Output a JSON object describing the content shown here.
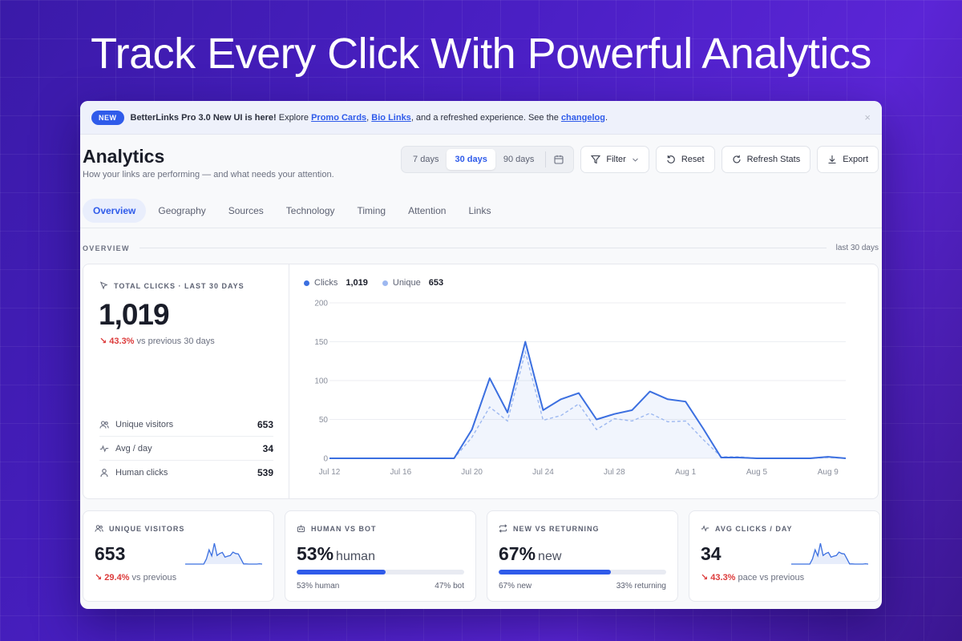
{
  "headline": "Track Every Click With Powerful Analytics",
  "banner": {
    "badge": "NEW",
    "lead": "BetterLinks Pro 3.0 New UI is here!",
    "text1": " Explore ",
    "link1": "Promo Cards",
    "sep": ", ",
    "link2": "Bio Links",
    "text2": ", and a refreshed experience. See the ",
    "link3": "changelog",
    "end": ".",
    "close": "×"
  },
  "page": {
    "title": "Analytics",
    "subtitle": "How your links are performing — and what needs your attention."
  },
  "controls": {
    "ranges": [
      "7 days",
      "30 days",
      "90 days"
    ],
    "active_range": "30 days",
    "filter": "Filter",
    "reset": "Reset",
    "refresh": "Refresh Stats",
    "export": "Export"
  },
  "tabs": [
    "Overview",
    "Geography",
    "Sources",
    "Technology",
    "Timing",
    "Attention",
    "Links"
  ],
  "active_tab": "Overview",
  "section": {
    "label": "OVERVIEW",
    "range": "last 30 days"
  },
  "kpi": {
    "label": "TOTAL CLICKS · LAST 30 DAYS",
    "value": "1,019",
    "delta": "↘ 43.3%",
    "delta_suffix": "vs previous 30 days"
  },
  "stats": [
    {
      "label": "Unique visitors",
      "value": "653"
    },
    {
      "label": "Avg / day",
      "value": "34"
    },
    {
      "label": "Human clicks",
      "value": "539"
    }
  ],
  "legend": {
    "clicks_label": "Clicks",
    "clicks_value": "1,019",
    "unique_label": "Unique",
    "unique_value": "653"
  },
  "colors": {
    "accent": "#2f5bea",
    "clicks": "#3b6fe0",
    "unique": "#9db8f0",
    "negative": "#dc3a3a"
  },
  "chart_data": {
    "type": "line",
    "x": [
      "Jul 12",
      "Jul 13",
      "Jul 14",
      "Jul 15",
      "Jul 16",
      "Jul 17",
      "Jul 18",
      "Jul 19",
      "Jul 20",
      "Jul 21",
      "Jul 22",
      "Jul 23",
      "Jul 24",
      "Jul 25",
      "Jul 26",
      "Jul 27",
      "Jul 28",
      "Jul 29",
      "Jul 30",
      "Jul 31",
      "Aug 1",
      "Aug 2",
      "Aug 3",
      "Aug 4",
      "Aug 5",
      "Aug 6",
      "Aug 7",
      "Aug 8",
      "Aug 9",
      "Aug 10"
    ],
    "x_tick_labels": [
      "Jul 12",
      "Jul 16",
      "Jul 20",
      "Jul 24",
      "Jul 28",
      "Aug 1",
      "Aug 5",
      "Aug 9"
    ],
    "y_ticks": [
      0,
      50,
      100,
      150,
      200
    ],
    "ylim": [
      0,
      200
    ],
    "series": [
      {
        "name": "Clicks",
        "values": [
          0,
          0,
          0,
          0,
          0,
          0,
          0,
          0,
          37,
          103,
          59,
          150,
          62,
          76,
          84,
          50,
          57,
          62,
          86,
          76,
          73,
          38,
          1,
          1,
          0,
          0,
          0,
          0,
          2,
          0
        ]
      },
      {
        "name": "Unique",
        "values": [
          0,
          0,
          0,
          0,
          0,
          0,
          0,
          0,
          27,
          66,
          48,
          137,
          49,
          55,
          70,
          37,
          51,
          48,
          58,
          47,
          48,
          24,
          2,
          2,
          0,
          0,
          0,
          0,
          1,
          0
        ]
      }
    ],
    "grid": true,
    "legend": "top-left"
  },
  "cards": [
    {
      "label": "UNIQUE VISITORS",
      "value": "653",
      "suffix": "",
      "delta": "↘ 29.4%",
      "delta_suffix": "vs previous",
      "kind": "spark",
      "icon": "users-icon"
    },
    {
      "label": "HUMAN VS BOT",
      "value": "53%",
      "suffix": "human",
      "kind": "bar",
      "fill": 0.53,
      "left": "53% human",
      "right": "47% bot",
      "icon": "bot-icon"
    },
    {
      "label": "NEW VS RETURNING",
      "value": "67%",
      "suffix": "new",
      "kind": "bar",
      "fill": 0.67,
      "left": "67% new",
      "right": "33% returning",
      "icon": "repeat-icon"
    },
    {
      "label": "AVG CLICKS / DAY",
      "value": "34",
      "suffix": "",
      "delta": "↘ 43.3%",
      "delta_suffix": "pace vs previous",
      "kind": "spark",
      "icon": "activity-icon"
    }
  ]
}
